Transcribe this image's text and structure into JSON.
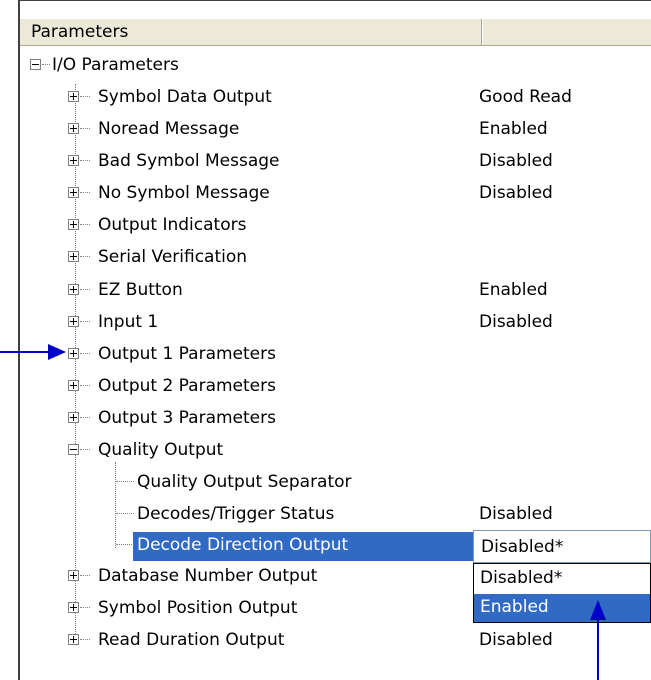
{
  "header": {
    "col1": "Parameters",
    "col2": ""
  },
  "root": {
    "label": "I/O Parameters"
  },
  "items": [
    {
      "label": "Symbol Data Output",
      "value": "Good Read"
    },
    {
      "label": "Noread Message",
      "value": "Enabled"
    },
    {
      "label": "Bad Symbol Message",
      "value": "Disabled"
    },
    {
      "label": "No Symbol Message",
      "value": "Disabled"
    },
    {
      "label": "Output Indicators",
      "value": ""
    },
    {
      "label": "Serial Verification",
      "value": ""
    },
    {
      "label": "EZ Button",
      "value": "Enabled"
    },
    {
      "label": "Input 1",
      "value": "Disabled"
    },
    {
      "label": "Output 1 Parameters",
      "value": ""
    },
    {
      "label": "Output 2 Parameters",
      "value": ""
    },
    {
      "label": "Output 3 Parameters",
      "value": ""
    },
    {
      "label": "Quality Output",
      "value": ""
    }
  ],
  "quality_children": [
    {
      "label": "Quality Output Separator",
      "value": ""
    },
    {
      "label": "Decodes/Trigger Status",
      "value": "Disabled"
    },
    {
      "label": "Decode Direction Output",
      "value": "Disabled*"
    }
  ],
  "after_items": [
    {
      "label": "Database Number Output",
      "value": ""
    },
    {
      "label": "Symbol Position Output",
      "value": ""
    },
    {
      "label": "Read Duration Output",
      "value": "Disabled"
    }
  ],
  "combo": {
    "selected": "Disabled*",
    "options": [
      "Disabled*",
      "Enabled"
    ],
    "highlighted": "Enabled"
  },
  "colors": {
    "selection": "#316ac5",
    "arrow": "#0000cc"
  }
}
